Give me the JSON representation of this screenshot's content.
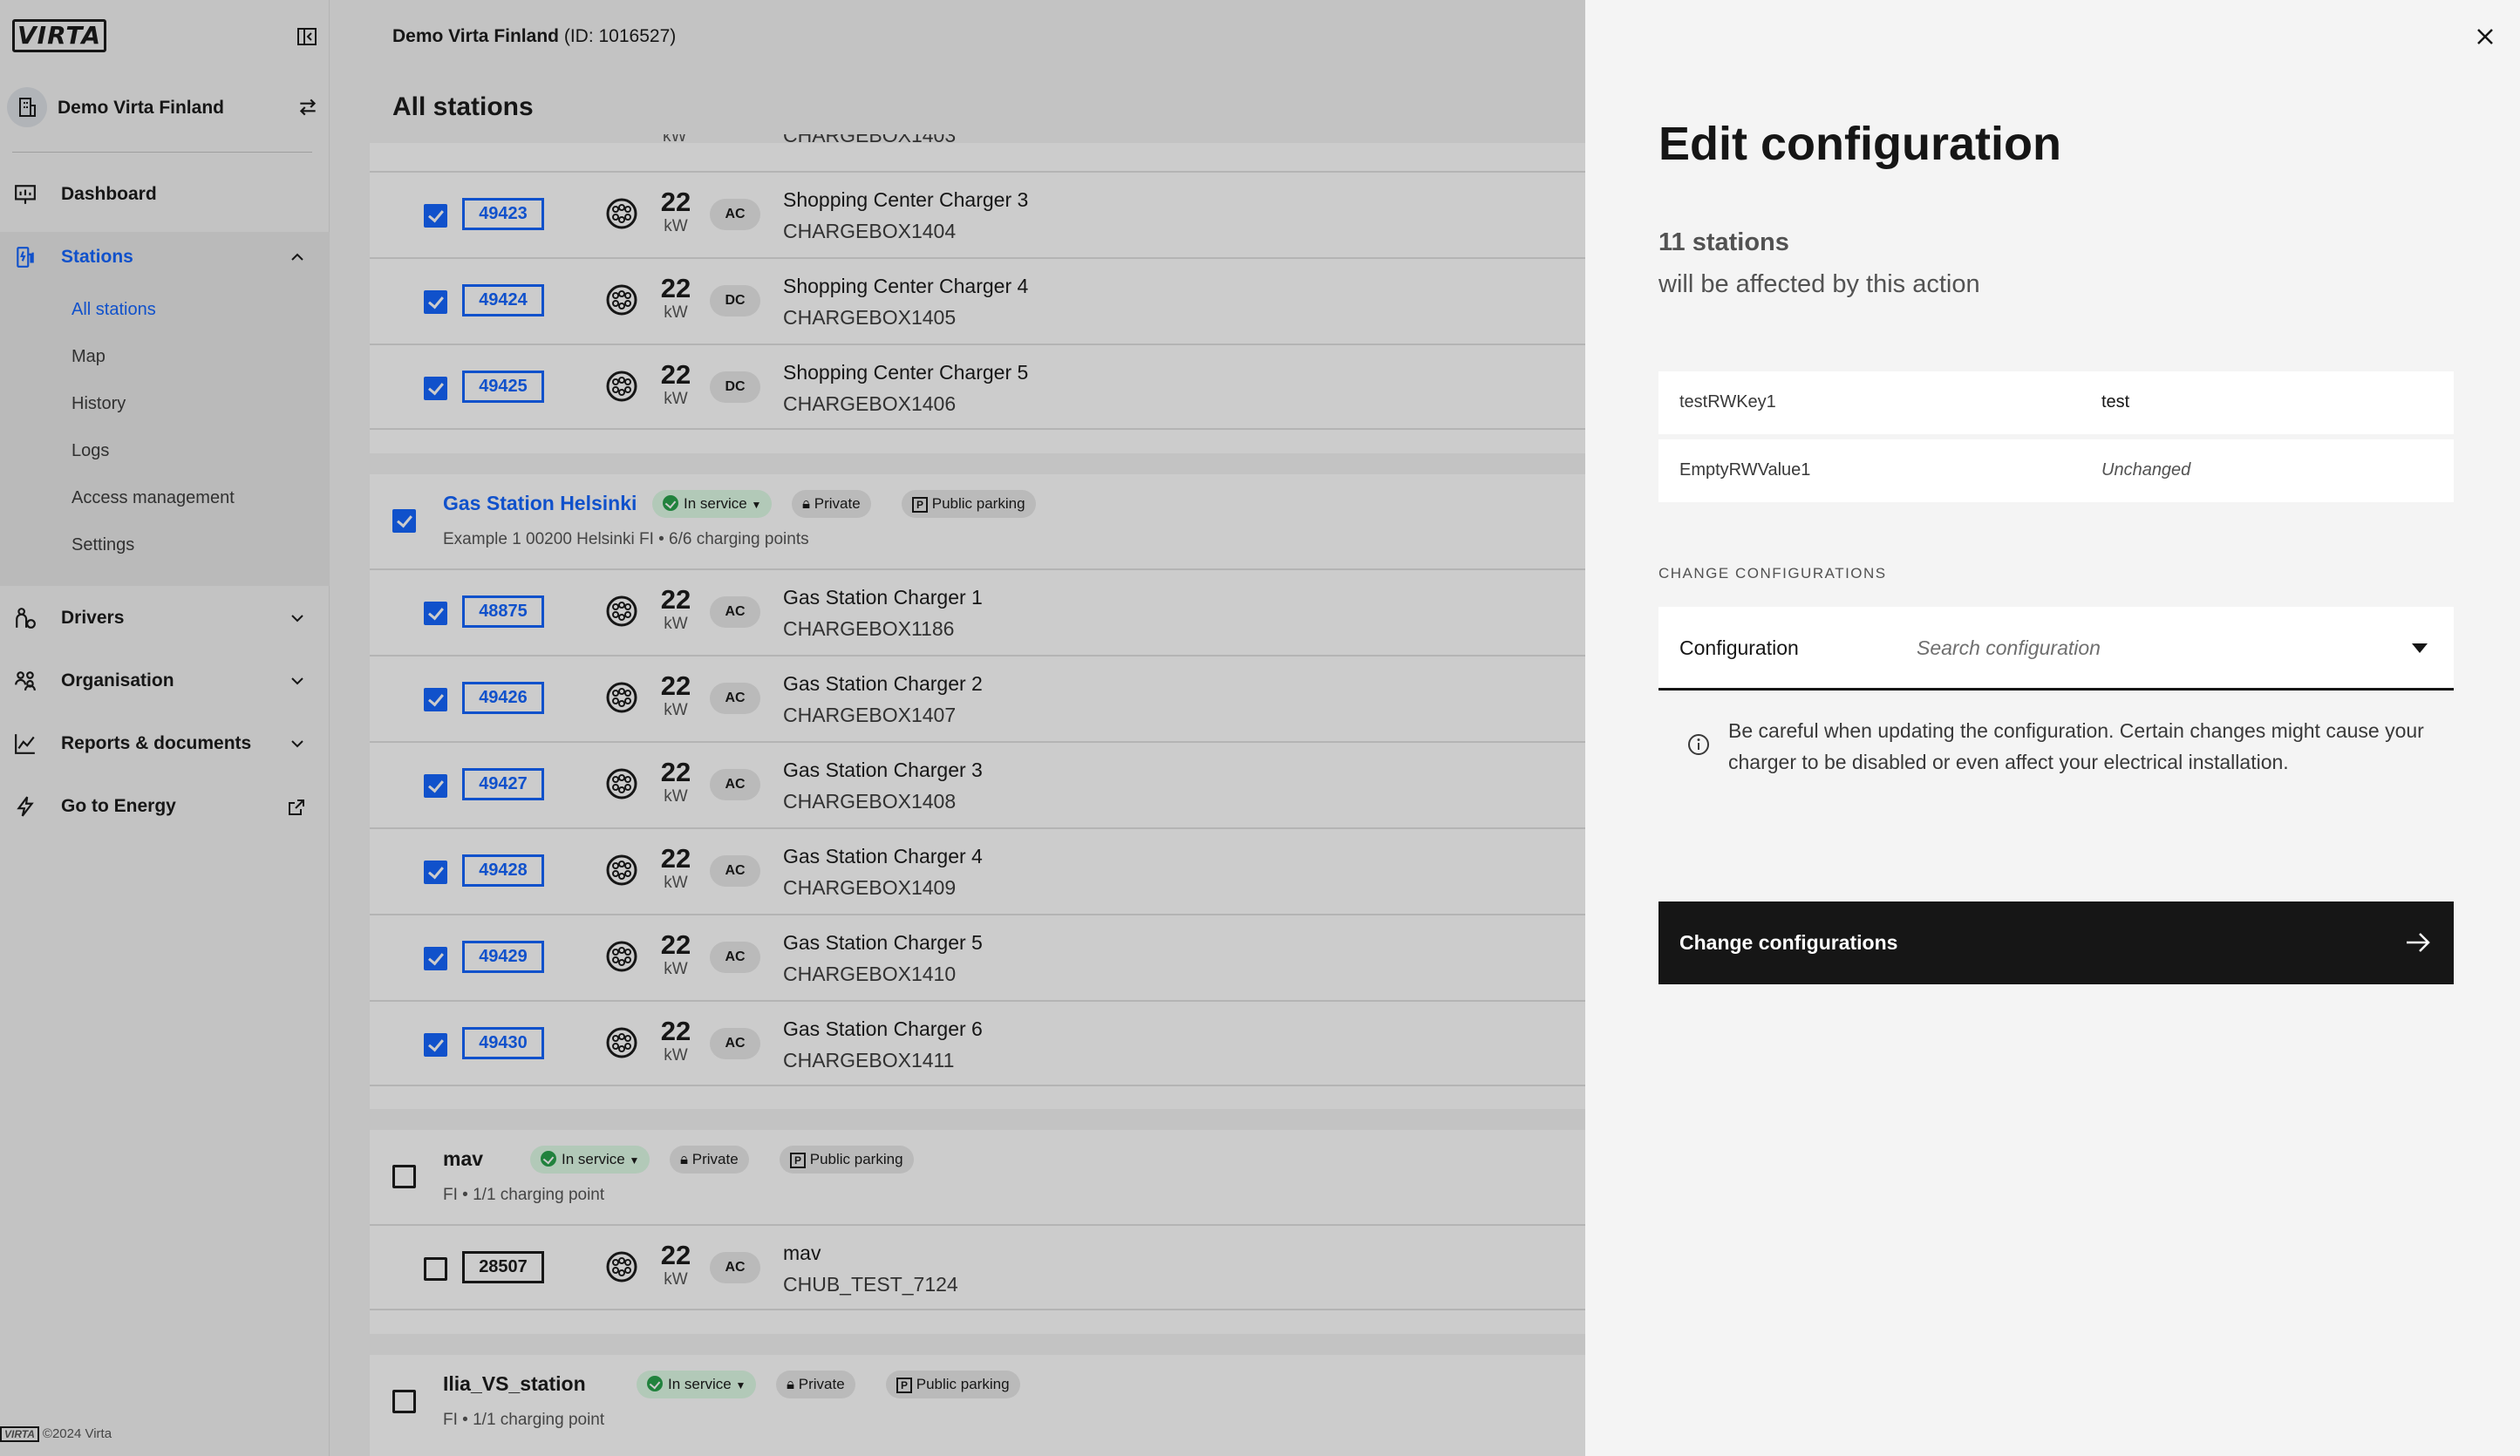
{
  "sidebar": {
    "logo": "VIRTA",
    "org_name": "Demo Virta Finland",
    "nav": {
      "dashboard": "Dashboard",
      "stations": "Stations",
      "drivers": "Drivers",
      "organisation": "Organisation",
      "reports": "Reports & documents",
      "energy": "Go to Energy"
    },
    "stations_sub": [
      "All stations",
      "Map",
      "History",
      "Logs",
      "Access management",
      "Settings"
    ],
    "footer_logo": "VIRTA",
    "footer": "©2024 Virta"
  },
  "main": {
    "org": "Demo Virta Finland",
    "org_id": "(ID: 1016527)",
    "title": "All stations",
    "partial_row": {
      "kw_unit": "kW",
      "chargebox": "CHARGEBOX1403"
    },
    "group1": {
      "rows": [
        {
          "id": "49423",
          "kw": "22",
          "unit": "kW",
          "type": "AC",
          "name": "Shopping Center Charger 3",
          "box": "CHARGEBOX1404"
        },
        {
          "id": "49424",
          "kw": "22",
          "unit": "kW",
          "type": "DC",
          "name": "Shopping Center Charger 4",
          "box": "CHARGEBOX1405"
        },
        {
          "id": "49425",
          "kw": "22",
          "unit": "kW",
          "type": "DC",
          "name": "Shopping Center Charger 5",
          "box": "CHARGEBOX1406"
        }
      ]
    },
    "group2": {
      "title": "Gas Station Helsinki",
      "status": "In service",
      "access": "Private",
      "parking": "Public parking",
      "parking_letter": "P",
      "address": "Example 1 00200 Helsinki FI • 6/6 charging points",
      "rows": [
        {
          "id": "48875",
          "kw": "22",
          "unit": "kW",
          "type": "AC",
          "name": "Gas Station Charger 1",
          "box": "CHARGEBOX1186"
        },
        {
          "id": "49426",
          "kw": "22",
          "unit": "kW",
          "type": "AC",
          "name": "Gas Station Charger 2",
          "box": "CHARGEBOX1407"
        },
        {
          "id": "49427",
          "kw": "22",
          "unit": "kW",
          "type": "AC",
          "name": "Gas Station Charger 3",
          "box": "CHARGEBOX1408"
        },
        {
          "id": "49428",
          "kw": "22",
          "unit": "kW",
          "type": "AC",
          "name": "Gas Station Charger 4",
          "box": "CHARGEBOX1409"
        },
        {
          "id": "49429",
          "kw": "22",
          "unit": "kW",
          "type": "AC",
          "name": "Gas Station Charger 5",
          "box": "CHARGEBOX1410"
        },
        {
          "id": "49430",
          "kw": "22",
          "unit": "kW",
          "type": "AC",
          "name": "Gas Station Charger 6",
          "box": "CHARGEBOX1411"
        }
      ]
    },
    "group3": {
      "title": "mav",
      "status": "In service",
      "access": "Private",
      "parking": "Public parking",
      "parking_letter": "P",
      "address": "FI • 1/1 charging point",
      "row": {
        "id": "28507",
        "kw": "22",
        "unit": "kW",
        "type": "AC",
        "name": "mav",
        "box": "CHUB_TEST_7124"
      }
    },
    "group4": {
      "title": "Ilia_VS_station",
      "status": "In service",
      "access": "Private",
      "parking": "Public parking",
      "parking_letter": "P",
      "address": "FI • 1/1 charging point"
    }
  },
  "panel": {
    "title": "Edit configuration",
    "count": "11 stations",
    "affected": "will be affected by this action",
    "config_rows": [
      {
        "key": "testRWKey1",
        "value": "test"
      },
      {
        "key": "EmptyRWValue1",
        "value": "Unchanged"
      }
    ],
    "section_label": "CHANGE CONFIGURATIONS",
    "config_label": "Configuration",
    "config_placeholder": "Search configuration",
    "warning": "Be careful when updating the configuration. Certain changes might cause your charger to be disabled or even affect your electrical installation.",
    "cta": "Change configurations"
  },
  "colors": {
    "accent": "#0f62fe",
    "success": "#24a148",
    "dark": "#161616"
  }
}
